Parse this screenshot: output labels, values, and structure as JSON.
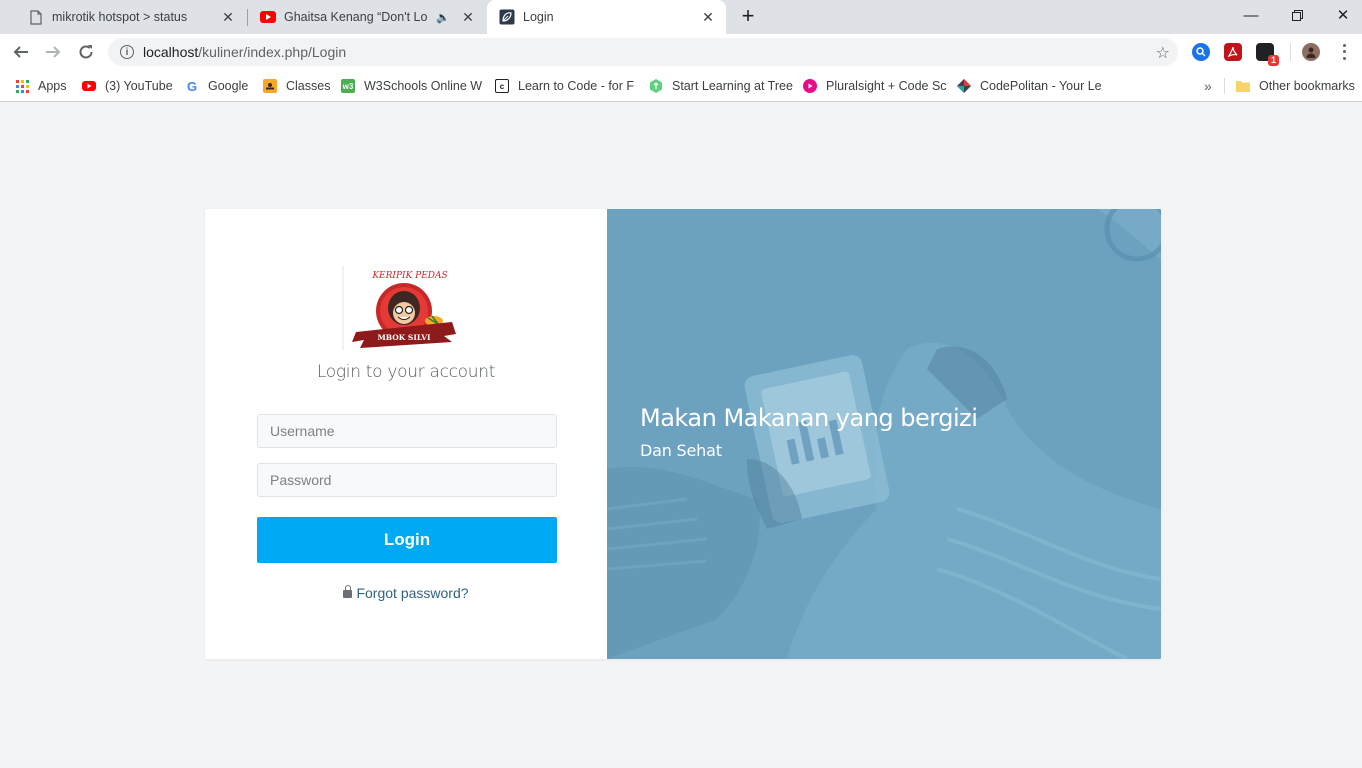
{
  "browser": {
    "tabs": [
      {
        "title": "mikrotik hotspot > status",
        "icon": "document-icon",
        "active": false
      },
      {
        "title": "Ghaitsa Kenang “Don't Look",
        "icon": "youtube-icon",
        "active": false
      },
      {
        "title": "Login",
        "icon": "leaf-icon",
        "active": true
      }
    ],
    "url_host": "localhost",
    "url_path": "/kuliner/index.php/Login",
    "extension_badge": "1",
    "bookmarks": [
      {
        "label": "Apps",
        "icon": "apps-grid-icon"
      },
      {
        "label": "(3) YouTube",
        "icon": "youtube-icon"
      },
      {
        "label": "Google",
        "icon": "google-icon"
      },
      {
        "label": "Classes",
        "icon": "classes-icon"
      },
      {
        "label": "W3Schools Online W",
        "icon": "w3schools-icon"
      },
      {
        "label": "Learn to Code - for F",
        "icon": "codecademy-icon"
      },
      {
        "label": "Start Learning at Tree",
        "icon": "treehouse-icon"
      },
      {
        "label": "Pluralsight + Code Sc",
        "icon": "pluralsight-icon"
      },
      {
        "label": "CodePolitan - Your Le",
        "icon": "codepolitan-icon"
      }
    ],
    "bookmarks_overflow": "»",
    "other_bookmarks": "Other bookmarks"
  },
  "login": {
    "logo_text_top": "KERIPIK PEDAS",
    "logo_text_bottom": "MBOK SILVI",
    "heading": "Login to your account",
    "username_placeholder": "Username",
    "password_placeholder": "Password",
    "button_label": "Login",
    "forgot_label": "Forgot password?"
  },
  "hero": {
    "title": "Makan Makanan yang bergizi",
    "subtitle": "Dan Sehat",
    "overlay_color": "#6ca2c0"
  },
  "colors": {
    "primary_button": "#00a9f4",
    "link": "#31627f"
  }
}
